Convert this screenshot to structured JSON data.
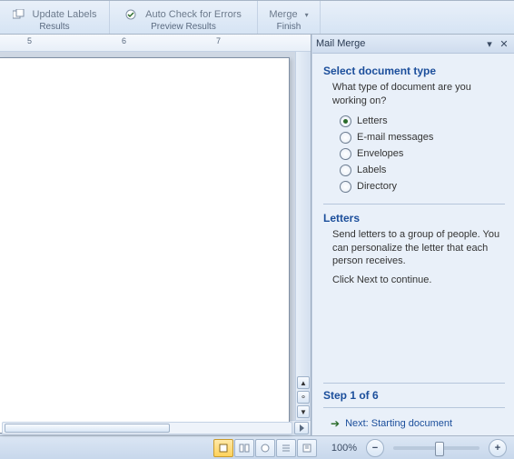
{
  "ribbon": {
    "update_labels": "Update Labels",
    "results": "Results",
    "auto_check": "Auto Check for Errors",
    "preview_group": "Preview Results",
    "merge": "Merge",
    "finish_group": "Finish"
  },
  "ruler": {
    "n5": "5",
    "n6": "6",
    "n7": "7"
  },
  "panel": {
    "title": "Mail Merge",
    "select_heading": "Select document type",
    "select_question": "What type of document are you working on?",
    "options": {
      "letters": "Letters",
      "email": "E-mail messages",
      "envelopes": "Envelopes",
      "labels": "Labels",
      "directory": "Directory"
    },
    "letters_heading": "Letters",
    "letters_desc": "Send letters to a group of people. You can personalize the letter that each person receives.",
    "click_next": "Click Next to continue.",
    "step": "Step 1 of 6",
    "next_link": "Next: Starting document"
  },
  "status": {
    "zoom": "100%"
  }
}
